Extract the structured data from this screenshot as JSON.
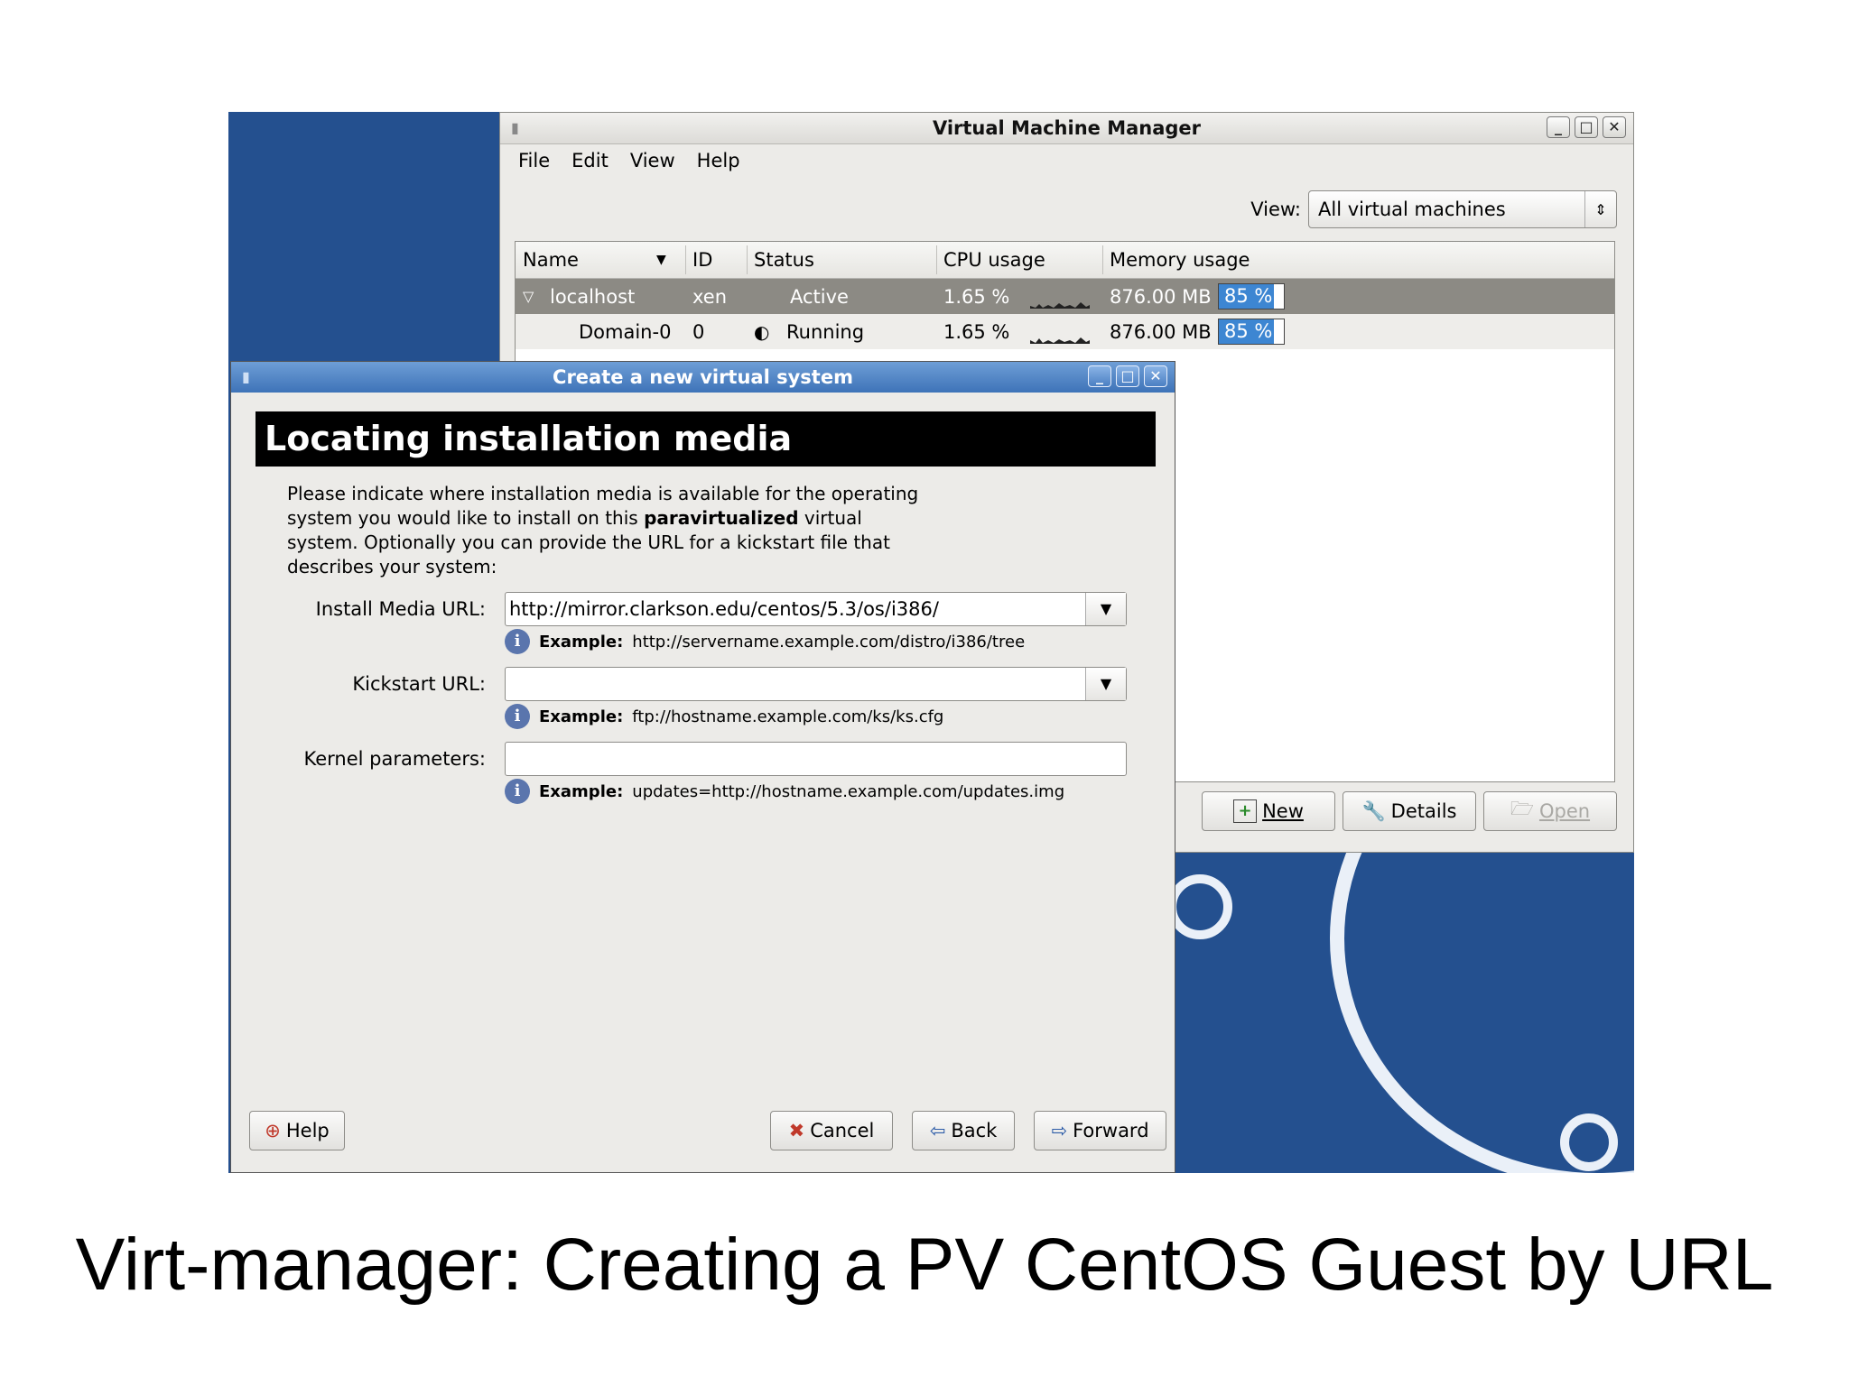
{
  "vmm": {
    "title": "Virtual Machine Manager",
    "menu": [
      "File",
      "Edit",
      "View",
      "Help"
    ],
    "view_label": "View:",
    "view_value": "All virtual machines",
    "columns": [
      "Name",
      "ID",
      "Status",
      "CPU usage",
      "Memory usage"
    ],
    "rows": [
      {
        "name": "localhost",
        "id": "xen",
        "status": "Active",
        "cpu": "1.65 %",
        "mem": "876.00 MB",
        "mem_pct_label": "85 %",
        "mem_pct": 85
      },
      {
        "name": "Domain-0",
        "id": "0",
        "status": "Running",
        "cpu": "1.65 %",
        "mem": "876.00 MB",
        "mem_pct_label": "85 %",
        "mem_pct": 85
      }
    ],
    "buttons": {
      "new": "New",
      "details": "Details",
      "open": "Open"
    }
  },
  "dialog": {
    "title": "Create a new virtual system",
    "heading": "Locating installation media",
    "desc_1": "Please indicate where installation media is available for the operating system you would like to install on this",
    "desc_bold": "paravirtualized",
    "desc_2": "virtual system. Optionally you can provide the URL for a kickstart file that describes your system:",
    "install_label": "Install Media URL:",
    "install_value": "http://mirror.clarkson.edu/centos/5.3/os/i386/",
    "install_example_bold": "Example:",
    "install_example": "http://servername.example.com/distro/i386/tree",
    "kickstart_label": "Kickstart URL:",
    "kickstart_value": "",
    "kickstart_example_bold": "Example:",
    "kickstart_example": "ftp://hostname.example.com/ks/ks.cfg",
    "kernel_label": "Kernel parameters:",
    "kernel_value": "",
    "kernel_example_bold": "Example:",
    "kernel_example": "updates=http://hostname.example.com/updates.img",
    "help_label": "Help",
    "cancel_label": "Cancel",
    "back_label": "Back",
    "forward_label": "Forward"
  },
  "caption": "Virt-manager: Creating a PV CentOS Guest by URL",
  "colors": {
    "desktop": "#24508f",
    "selection": "#3d86d2",
    "dialog_title": "#4a7fc1"
  }
}
